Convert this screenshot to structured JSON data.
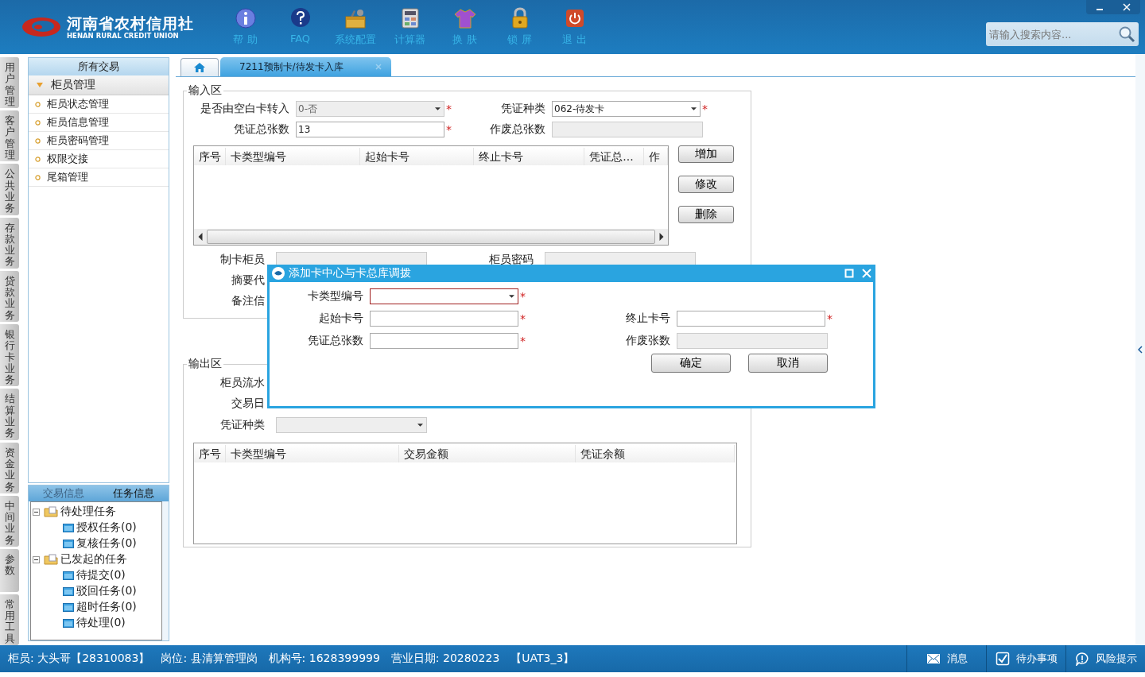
{
  "header": {
    "logo_cn": "河南省农村信用社",
    "logo_en": "HENAN RURAL CREDIT UNION",
    "tools": [
      {
        "label": "帮 助",
        "kind": "info"
      },
      {
        "label": "FAQ",
        "kind": "faq"
      },
      {
        "label": "系统配置",
        "kind": "toolbox"
      },
      {
        "label": "计算器",
        "kind": "calculator"
      },
      {
        "label": "换 肤",
        "kind": "shirt"
      },
      {
        "label": "锁 屏",
        "kind": "lock"
      },
      {
        "label": "退 出",
        "kind": "power"
      }
    ],
    "search": {
      "placeholder": "请输入搜索内容..."
    }
  },
  "side_tabs": [
    "用户管理",
    "客户管理",
    "公共业务",
    "存款业务",
    "贷款业务",
    "银行卡业务",
    "结算业务",
    "资金业务",
    "中间业务",
    "参数",
    "常用工具"
  ],
  "menu": {
    "title": "所有交易",
    "group": {
      "label": "柜员管理",
      "expanded": true
    },
    "items": [
      "柜员状态管理",
      "柜员信息管理",
      "柜员密码管理",
      "权限交接",
      "尾箱管理"
    ]
  },
  "info_tabs": [
    {
      "label": "交易信息",
      "selected": false
    },
    {
      "label": "任务信息",
      "selected": true
    }
  ],
  "task_tree": [
    {
      "label": "待处理任务",
      "expanded": true,
      "children": [
        {
          "label": "授权任务(0)"
        },
        {
          "label": "复核任务(0)"
        }
      ]
    },
    {
      "label": "已发起的任务",
      "expanded": true,
      "children": [
        {
          "label": "待提交(0)"
        },
        {
          "label": "驳回任务(0)"
        },
        {
          "label": "超时任务(0)"
        },
        {
          "label": "待处理(0)"
        }
      ]
    }
  ],
  "tab": {
    "label": "7211预制卡/待发卡入库"
  },
  "input_area": {
    "title": "输入区",
    "fields": [
      {
        "label": "是否由空白卡转入",
        "value": "0-否",
        "kind": "select",
        "disabled": true,
        "required_mark": "*"
      },
      {
        "label": "凭证种类",
        "value": "062-待发卡",
        "kind": "select",
        "disabled": false,
        "required_mark": "*"
      },
      {
        "label": "凭证总张数",
        "value": "13",
        "kind": "text",
        "disabled": false,
        "required_mark": "*"
      },
      {
        "label": "作废总张数",
        "kind": "text",
        "disabled": true
      }
    ],
    "grid_columns": [
      "序号",
      "卡类型编号",
      "起始卡号",
      "终止卡号",
      "凭证总...",
      "作"
    ],
    "buttons": [
      "增加",
      "修改",
      "删除"
    ],
    "lower_fields": [
      {
        "label": "制卡柜员"
      },
      {
        "label": "柜员密码"
      },
      {
        "label": "摘要代"
      },
      {
        "label": "备注信"
      }
    ]
  },
  "output_area": {
    "title": "输出区",
    "labels": [
      "柜员流水",
      "交易日"
    ],
    "voucher_field": {
      "label": "凭证种类",
      "disabled": true
    },
    "grid_columns": [
      "序号",
      "卡类型编号",
      "交易金额",
      "凭证余额"
    ]
  },
  "dialog": {
    "title": "添加卡中心与卡总库调拨",
    "fields": [
      {
        "label": "卡类型编号",
        "kind": "select",
        "focused": true,
        "disabled": false,
        "required_mark": "*"
      },
      {
        "label": "起始卡号",
        "kind": "text",
        "focused": false,
        "disabled": false,
        "required_mark": "*"
      },
      {
        "label": "终止卡号",
        "kind": "text",
        "focused": false,
        "disabled": false,
        "required_mark": "*"
      },
      {
        "label": "凭证总张数",
        "kind": "text",
        "focused": false,
        "disabled": false,
        "required_mark": "*"
      },
      {
        "label": "作废张数",
        "kind": "text",
        "focused": false,
        "disabled": true
      }
    ],
    "buttons": [
      "确定",
      "取消"
    ]
  },
  "status_bar": {
    "items": [
      "柜员: 大头哥【28310083】",
      "岗位: 县清算管理岗",
      "机构号: 1628399999",
      "营业日期: 20280223",
      "【UAT3_3】"
    ],
    "buttons": [
      {
        "label": "消息",
        "kind": "mail"
      },
      {
        "label": "待办事项",
        "kind": "check"
      },
      {
        "label": "风险提示",
        "kind": "alert"
      }
    ]
  }
}
